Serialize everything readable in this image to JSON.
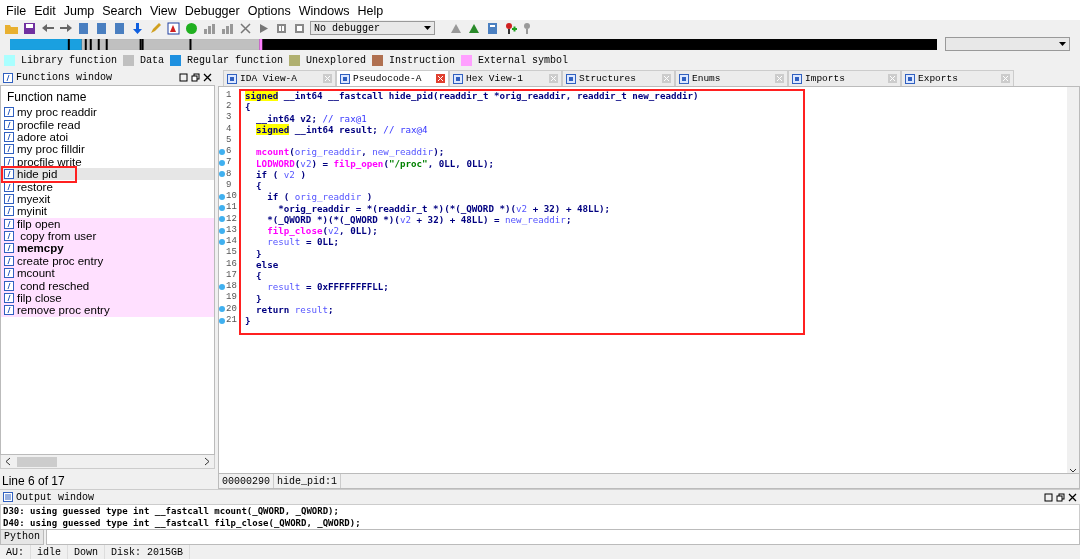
{
  "menu": [
    "File",
    "Edit",
    "Jump",
    "Search",
    "View",
    "Debugger",
    "Options",
    "Windows",
    "Help"
  ],
  "toolbar": {
    "debugger_select": "No debugger"
  },
  "legend": [
    {
      "label": "Library function",
      "color": "#aaffff"
    },
    {
      "label": "Data",
      "color": "#c0c0c0"
    },
    {
      "label": "Regular function",
      "color": "#1e90e0"
    },
    {
      "label": "Unexplored",
      "color": "#b0b070"
    },
    {
      "label": "Instruction",
      "color": "#b07050"
    },
    {
      "label": "External symbol",
      "color": "#ffa0ff"
    }
  ],
  "functions_window": {
    "title": "Functions window",
    "column": "Function name",
    "items": [
      {
        "name": "my proc readdir",
        "selected": false,
        "kind": "local",
        "bold": false
      },
      {
        "name": "procfile read",
        "selected": false,
        "kind": "local",
        "bold": false
      },
      {
        "name": "adore atoi",
        "selected": false,
        "kind": "local",
        "bold": false
      },
      {
        "name": "my proc filldir",
        "selected": false,
        "kind": "local",
        "bold": false
      },
      {
        "name": "procfile write",
        "selected": false,
        "kind": "local",
        "bold": false
      },
      {
        "name": "hide pid",
        "selected": true,
        "kind": "local",
        "bold": false
      },
      {
        "name": "restore",
        "selected": false,
        "kind": "local",
        "bold": false
      },
      {
        "name": "myexit",
        "selected": false,
        "kind": "local",
        "bold": false
      },
      {
        "name": "myinit",
        "selected": false,
        "kind": "local",
        "bold": false
      },
      {
        "name": "filp open",
        "selected": false,
        "kind": "import",
        "bold": false
      },
      {
        "name": " copy from user",
        "selected": false,
        "kind": "import",
        "bold": false
      },
      {
        "name": "memcpy",
        "selected": false,
        "kind": "import",
        "bold": true
      },
      {
        "name": "create proc entry",
        "selected": false,
        "kind": "import",
        "bold": false
      },
      {
        "name": "mcount",
        "selected": false,
        "kind": "import",
        "bold": false
      },
      {
        "name": " cond resched",
        "selected": false,
        "kind": "import",
        "bold": false
      },
      {
        "name": "filp close",
        "selected": false,
        "kind": "import",
        "bold": false
      },
      {
        "name": "remove proc entry",
        "selected": false,
        "kind": "import",
        "bold": false
      }
    ],
    "status": "Line 6 of 17"
  },
  "tabs": [
    {
      "label": "IDA View-A",
      "selected": false
    },
    {
      "label": "Pseudocode-A",
      "selected": true
    },
    {
      "label": "Hex View-1",
      "selected": false
    },
    {
      "label": "Structures",
      "selected": false
    },
    {
      "label": "Enums",
      "selected": false
    },
    {
      "label": "Imports",
      "selected": false
    },
    {
      "label": "Exports",
      "selected": false
    }
  ],
  "pseudocode": {
    "lines": [
      {
        "number": "1",
        "has_code": false,
        "tokens": [
          {
            "kind": "hl",
            "text": "signed"
          },
          {
            "kind": "p",
            "text": " __int64 __fastcall hide_pid(readdir_t *orig_readdir, readdir_t new_readdir)"
          }
        ]
      },
      {
        "number": "2",
        "has_code": false,
        "tokens": [
          {
            "kind": "p",
            "text": "{"
          }
        ]
      },
      {
        "number": "3",
        "has_code": false,
        "tokens": [
          {
            "kind": "p",
            "text": "  __int64 v2; "
          },
          {
            "kind": "c",
            "text": "// rax@1"
          }
        ]
      },
      {
        "number": "4",
        "has_code": false,
        "tokens": [
          {
            "kind": "hl",
            "text": "  signed"
          },
          {
            "kind": "p",
            "text": " __int64 result; "
          },
          {
            "kind": "c",
            "text": "// rax@4"
          }
        ]
      },
      {
        "number": "5",
        "has_code": false
      },
      {
        "number": "6",
        "has_code": true,
        "tokens": [
          {
            "kind": "f",
            "text": "  mcount"
          },
          {
            "kind": "p",
            "text": "("
          },
          {
            "kind": "v",
            "text": "orig_readdir"
          },
          {
            "kind": "p",
            "text": ", "
          },
          {
            "kind": "v",
            "text": "new_readdir"
          },
          {
            "kind": "p",
            "text": ");"
          }
        ]
      },
      {
        "number": "7",
        "has_code": true,
        "tokens": [
          {
            "kind": "f",
            "text": "  LODWORD"
          },
          {
            "kind": "p",
            "text": "("
          },
          {
            "kind": "v",
            "text": "v2"
          },
          {
            "kind": "p",
            "text": ") = "
          },
          {
            "kind": "f",
            "text": "filp_open"
          },
          {
            "kind": "p",
            "text": "("
          },
          {
            "kind": "s",
            "text": "\"/proc\""
          },
          {
            "kind": "p",
            "text": ", 0LL, 0LL);"
          }
        ]
      },
      {
        "number": "8",
        "has_code": true,
        "tokens": [
          {
            "kind": "p",
            "text": "  if ( "
          },
          {
            "kind": "v",
            "text": "v2"
          },
          {
            "kind": "p",
            "text": " )"
          }
        ]
      },
      {
        "number": "9",
        "has_code": false,
        "tokens": [
          {
            "kind": "p",
            "text": "  {"
          }
        ]
      },
      {
        "number": "10",
        "has_code": true,
        "tokens": [
          {
            "kind": "p",
            "text": "    if ( "
          },
          {
            "kind": "v",
            "text": "orig_readdir"
          },
          {
            "kind": "p",
            "text": " )"
          }
        ]
      },
      {
        "number": "11",
        "has_code": true,
        "tokens": [
          {
            "kind": "p",
            "text": "      *orig_readdir = *(readdir_t *)(*(_QWORD *)("
          },
          {
            "kind": "v",
            "text": "v2"
          },
          {
            "kind": "p",
            "text": " + 32) + 48LL);"
          }
        ]
      },
      {
        "number": "12",
        "has_code": true,
        "tokens": [
          {
            "kind": "p",
            "text": "    *(_QWORD *)(*(_QWORD *)("
          },
          {
            "kind": "v",
            "text": "v2"
          },
          {
            "kind": "p",
            "text": " + 32) + 48LL) = "
          },
          {
            "kind": "v",
            "text": "new_readdir"
          },
          {
            "kind": "p",
            "text": ";"
          }
        ]
      },
      {
        "number": "13",
        "has_code": true,
        "tokens": [
          {
            "kind": "f",
            "text": "    filp_close"
          },
          {
            "kind": "p",
            "text": "("
          },
          {
            "kind": "v",
            "text": "v2"
          },
          {
            "kind": "p",
            "text": ", 0LL);"
          }
        ]
      },
      {
        "number": "14",
        "has_code": true,
        "tokens": [
          {
            "kind": "v",
            "text": "    result"
          },
          {
            "kind": "p",
            "text": " = 0LL;"
          }
        ]
      },
      {
        "number": "15",
        "has_code": false,
        "tokens": [
          {
            "kind": "p",
            "text": "  }"
          }
        ]
      },
      {
        "number": "16",
        "has_code": false,
        "tokens": [
          {
            "kind": "p",
            "text": "  else"
          }
        ]
      },
      {
        "number": "17",
        "has_code": false,
        "tokens": [
          {
            "kind": "p",
            "text": "  {"
          }
        ]
      },
      {
        "number": "18",
        "has_code": true,
        "tokens": [
          {
            "kind": "v",
            "text": "    result"
          },
          {
            "kind": "p",
            "text": " = 0xFFFFFFFFLL;"
          }
        ]
      },
      {
        "number": "19",
        "has_code": false,
        "tokens": [
          {
            "kind": "p",
            "text": "  }"
          }
        ]
      },
      {
        "number": "20",
        "has_code": true,
        "tokens": [
          {
            "kind": "p",
            "text": "  return "
          },
          {
            "kind": "v",
            "text": "result"
          },
          {
            "kind": "p",
            "text": ";"
          }
        ]
      },
      {
        "number": "21",
        "has_code": true,
        "tokens": [
          {
            "kind": "p",
            "text": "}"
          }
        ]
      }
    ],
    "address": "00000290",
    "location": "hide_pid:1"
  },
  "output_window": {
    "title": "Output window",
    "lines": [
      "D30: using guessed type int __fastcall mcount(_QWORD, _QWORD);",
      "D40: using guessed type int __fastcall filp_close(_QWORD, _QWORD);"
    ],
    "python_button": "Python"
  },
  "status_bar": [
    "AU:",
    "idle",
    "Down",
    "Disk: 2015GB"
  ]
}
